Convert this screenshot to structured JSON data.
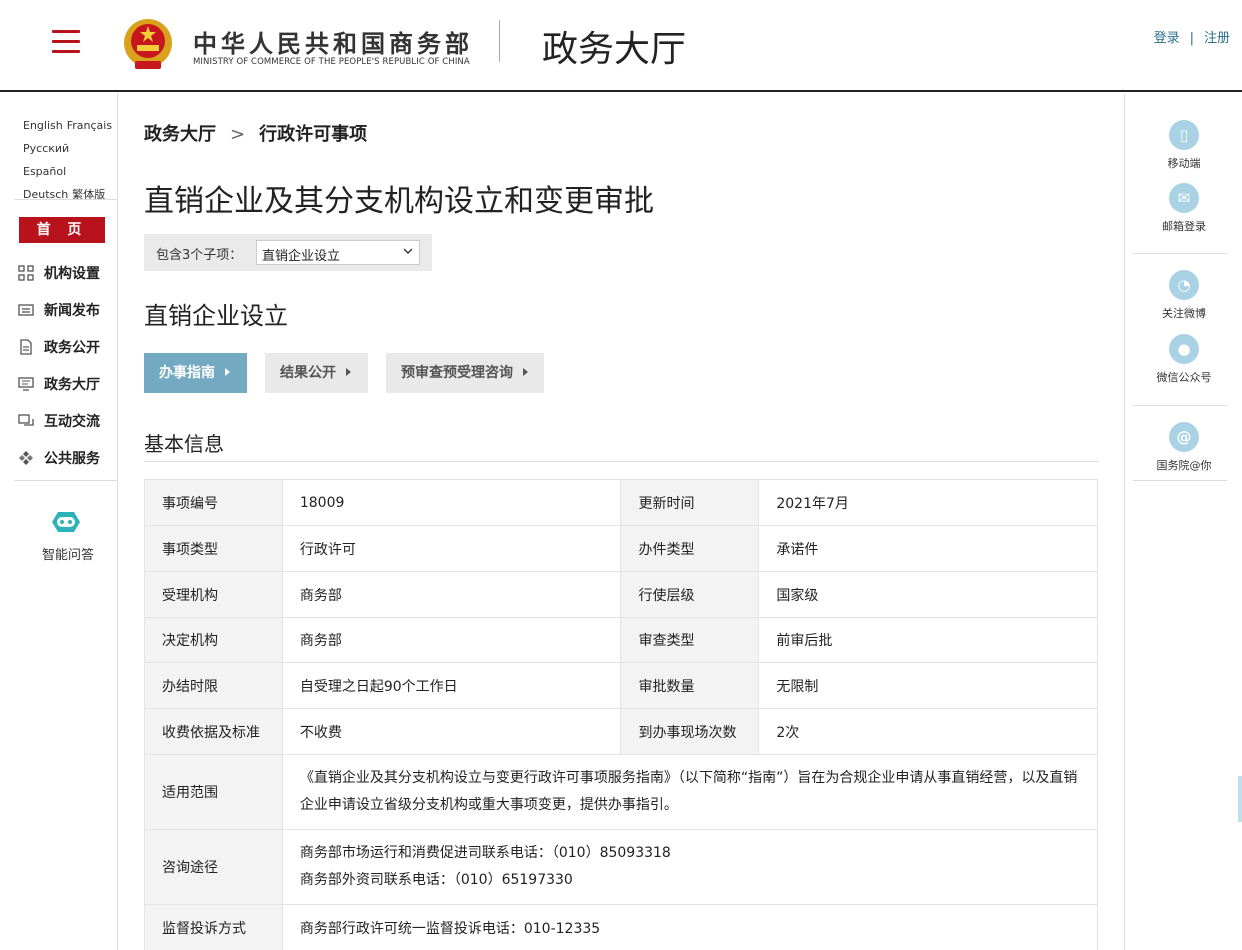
{
  "header": {
    "brand_cn": "中华人民共和国商务部",
    "brand_en": "MINISTRY OF COMMERCE OF THE PEOPLE'S REPUBLIC OF CHINA",
    "hall_title": "政务大厅",
    "login": "登录",
    "auth_sep": "|",
    "register": "注册"
  },
  "languages": [
    "English",
    "Français",
    "Русский",
    "Español",
    "Deutsch",
    "繁体版"
  ],
  "sidebar": {
    "home": "首 页",
    "items": [
      {
        "label": "机构设置",
        "icon": "grid-icon"
      },
      {
        "label": "新闻发布",
        "icon": "news-icon"
      },
      {
        "label": "政务公开",
        "icon": "document-icon"
      },
      {
        "label": "政务大厅",
        "icon": "monitor-icon"
      },
      {
        "label": "互动交流",
        "icon": "chat-icon"
      },
      {
        "label": "公共服务",
        "icon": "service-icon"
      }
    ],
    "ai_label": "智能问答"
  },
  "right_tools": [
    {
      "label": "移动端",
      "icon": "mobile-icon",
      "glyph": "▯"
    },
    {
      "label": "邮箱登录",
      "icon": "mail-icon",
      "glyph": "✉"
    },
    {
      "label": "关注微博",
      "icon": "weibo-icon",
      "glyph": "◔"
    },
    {
      "label": "微信公众号",
      "icon": "wechat-icon",
      "glyph": "●"
    },
    {
      "label": "国务院@你",
      "icon": "at-icon",
      "glyph": "@"
    }
  ],
  "breadcrumb": {
    "root": "政务大厅",
    "sep": ">",
    "current": "行政许可事项"
  },
  "page_title": "直销企业及其分支机构设立和变更审批",
  "subitems": {
    "label": "包含3个子项：",
    "selected": "直销企业设立"
  },
  "section_title": "直销企业设立",
  "tabs": [
    "办事指南",
    "结果公开",
    "预审查预受理咨询"
  ],
  "basic_info": {
    "title": "基本信息",
    "rows": [
      [
        "事项编号",
        "18009",
        "更新时间",
        "2021年7月"
      ],
      [
        "事项类型",
        "行政许可",
        "办件类型",
        "承诺件"
      ],
      [
        "受理机构",
        "商务部",
        "行使层级",
        "国家级"
      ],
      [
        "决定机构",
        "商务部",
        "审查类型",
        "前审后批"
      ],
      [
        "办结时限",
        "自受理之日起90个工作日",
        "审批数量",
        "无限制"
      ],
      [
        "收费依据及标准",
        "不收费",
        "到办事现场次数",
        "2次"
      ]
    ],
    "scope_label": "适用范围",
    "scope_text": "《直销企业及其分支机构设立与变更行政许可事项服务指南》（以下简称“指南”）旨在为合规企业申请从事直销经营，以及直销企业申请设立省级分支机构或重大事项变更，提供办事指引。",
    "consult_label": "咨询途径",
    "consult_lines": [
      "商务部市场运行和消费促进司联系电话：（010）85093318",
      "商务部外资司联系电话：（010）65197330"
    ],
    "complaint_label": "监督投诉方式",
    "complaint_text": "商务部行政许可统一监督投诉电话：010-12335"
  }
}
